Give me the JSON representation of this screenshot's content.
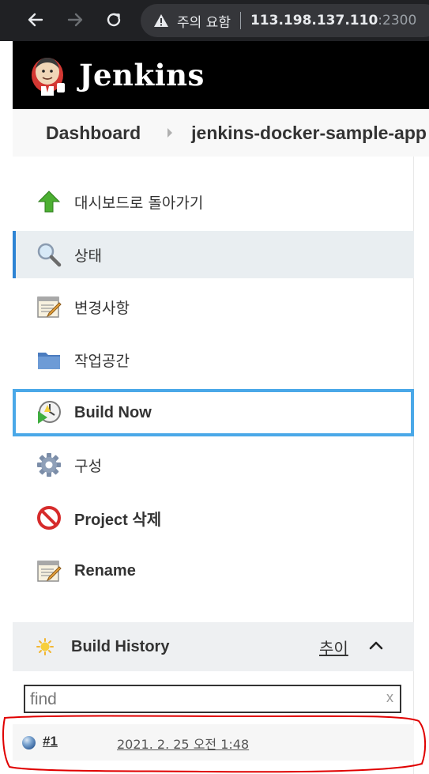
{
  "browser": {
    "warning_text": "주의 요함",
    "url_host": "113.198.137.110",
    "url_port": ":2300"
  },
  "header": {
    "title": "Jenkins"
  },
  "breadcrumb": {
    "items": [
      "Dashboard",
      "jenkins-docker-sample-app"
    ]
  },
  "tasks": [
    {
      "label": "대시보드로 돌아가기",
      "icon": "up-arrow-icon"
    },
    {
      "label": "상태",
      "icon": "search-icon"
    },
    {
      "label": "변경사항",
      "icon": "notepad-icon"
    },
    {
      "label": "작업공간",
      "icon": "folder-icon"
    },
    {
      "label": "Build Now",
      "icon": "clock-play-icon"
    },
    {
      "label": "구성",
      "icon": "gear-icon"
    },
    {
      "label": "Project 삭제",
      "icon": "no-entry-icon"
    },
    {
      "label": "Rename",
      "icon": "notepad-icon"
    }
  ],
  "build_history": {
    "title": "Build History",
    "trend_link": "추이",
    "find_placeholder": "find",
    "clear_symbol": "x",
    "builds": [
      {
        "number": "#1",
        "date": "2021. 2. 25 오전 1:48",
        "status_color": "#2f5c96"
      }
    ]
  },
  "colors": {
    "active_accent": "#2d84d4",
    "focus_border": "#4aa8e8",
    "annotation": "#e00000"
  }
}
